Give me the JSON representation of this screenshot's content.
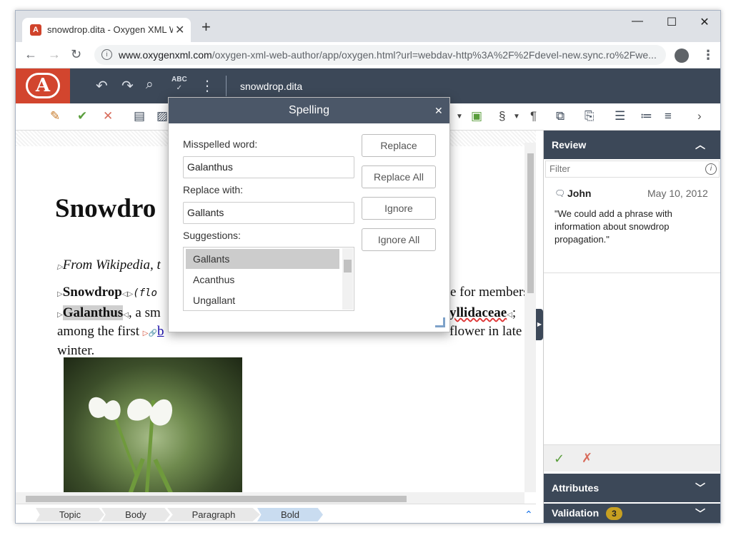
{
  "browser": {
    "tab_title": "snowdrop.dita - Oxygen XML We",
    "url_host": "www.oxygenxml.com",
    "url_path": "/oxygen-xml-web-author/app/oxygen.html?url=webdav-http%3A%2F%2Fdevel-new.sync.ro%2Fwe..."
  },
  "app": {
    "logo_letter": "A",
    "doc_name": "snowdrop.dita",
    "spell_label": "ABC"
  },
  "editor": {
    "title": "Snowdro",
    "line1": "From Wikipedia, t",
    "line2a": "Snowdrop",
    "line2b": "(flo",
    "line2c": "e for members",
    "line3a": "Galanthus",
    "line3b": ", a sm",
    "line3c": "yllidaceae",
    "line3d": ";",
    "line4a": "among the first",
    "line4b": "b",
    "line4c": "flower in late",
    "line5": "winter."
  },
  "breadcrumbs": [
    "Topic",
    "Body",
    "Paragraph",
    "Bold"
  ],
  "review": {
    "header": "Review",
    "filter_placeholder": "Filter",
    "comment_author": "John",
    "comment_date": "May 10, 2012",
    "comment_text": "\"We could add a phrase with information about snowdrop propagation.\"",
    "attributes_header": "Attributes",
    "validation_header": "Validation",
    "validation_count": "3"
  },
  "spelling": {
    "title": "Spelling",
    "misspelled_label": "Misspelled word:",
    "misspelled_value": "Galanthus",
    "replace_label": "Replace with:",
    "replace_value": "Gallants",
    "suggestions_label": "Suggestions:",
    "suggestions": [
      "Gallants",
      "Acanthus",
      "Ungallant"
    ],
    "btn_replace": "Replace",
    "btn_replace_all": "Replace All",
    "btn_ignore": "Ignore",
    "btn_ignore_all": "Ignore All"
  }
}
